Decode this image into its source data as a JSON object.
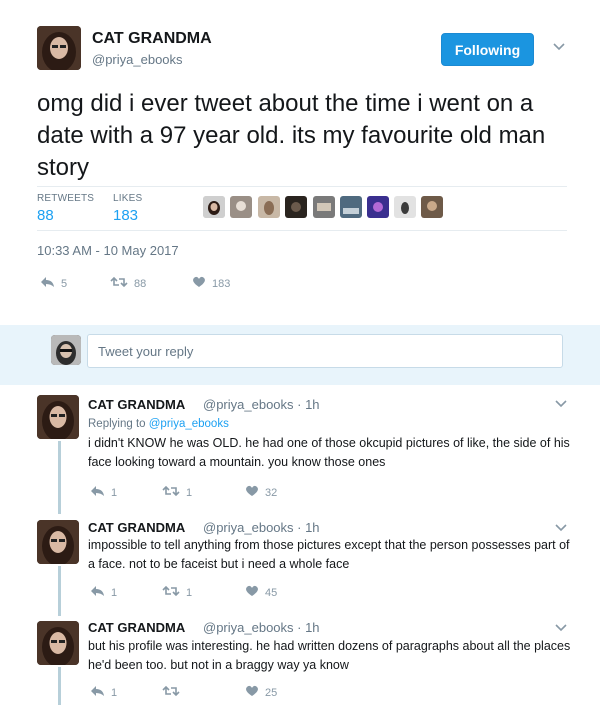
{
  "tweet": {
    "display_name": "CAT GRANDMA",
    "handle": "@priya_ebooks",
    "follow_label": "Following",
    "text": "omg did i ever tweet about the time i went on a date with a 97 year old. its my favourite old man story",
    "stats": {
      "retweets_label": "RETWEETS",
      "retweets": "88",
      "likes_label": "LIKES",
      "likes": "183"
    },
    "timestamp": "10:33 AM - 10 May 2017",
    "actions": {
      "reply": "5",
      "retweet": "88",
      "like": "183"
    }
  },
  "reply_box": {
    "placeholder": "Tweet your reply"
  },
  "replies": [
    {
      "display_name": "CAT GRANDMA",
      "handle_time": "@priya_ebooks · 1h",
      "replying_prefix": "Replying to",
      "replying_to": "@priya_ebooks",
      "text": "i didn't KNOW he was OLD. he had one of those okcupid pictures of like, the side of his face looking toward a mountain. you know those ones",
      "actions": {
        "reply": "1",
        "retweet": "1",
        "like": "32"
      }
    },
    {
      "display_name": "CAT GRANDMA",
      "handle_time": "@priya_ebooks · 1h",
      "text": "impossible to tell anything from those pictures except that the person possesses part of a face. not to be faceist but i need a whole face",
      "actions": {
        "reply": "1",
        "retweet": "1",
        "like": "45"
      }
    },
    {
      "display_name": "CAT GRANDMA",
      "handle_time": "@priya_ebooks · 1h",
      "text": "but his profile was interesting. he had written dozens of paragraphs about all the places he'd been too. but not in a braggy way ya know",
      "actions": {
        "reply": "1",
        "retweet": "",
        "like": "25"
      }
    }
  ],
  "colors": {
    "accent": "#1da1f2",
    "button": "#1b95e0",
    "reply_band": "#e8f4fb",
    "muted": "#657786"
  },
  "icons": [
    "chevron-down-icon",
    "reply-icon",
    "retweet-icon",
    "heart-icon"
  ]
}
